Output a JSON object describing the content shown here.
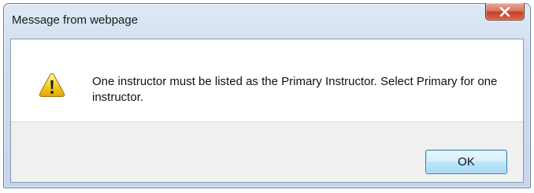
{
  "window": {
    "title": "Message from webpage"
  },
  "dialog": {
    "icon": "warning-icon",
    "message": "One instructor must be listed as the Primary Instructor.  Select Primary for one instructor.",
    "ok_label": "OK"
  },
  "colors": {
    "close_button": "#c4412a",
    "ok_border": "#3c7fb1",
    "warning_yellow": "#f5d22c"
  }
}
